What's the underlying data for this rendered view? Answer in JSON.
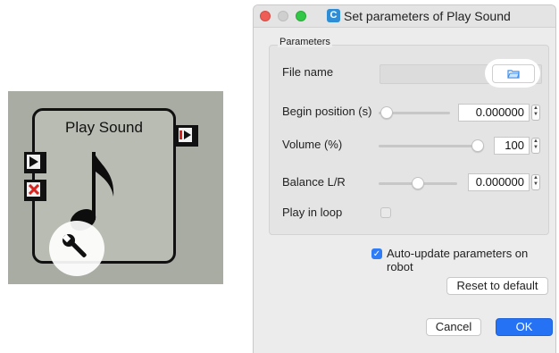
{
  "box": {
    "title": "Play Sound",
    "icons": [
      "start-input-port-icon",
      "stop-input-port-icon",
      "done-output-port-icon",
      "music-note-icon",
      "wrench-icon"
    ]
  },
  "dialog": {
    "app_icon": "C",
    "title": "Set parameters of Play Sound",
    "group_label": "Parameters",
    "file_name": {
      "label": "File name",
      "value": ""
    },
    "begin_position": {
      "label": "Begin position (s)",
      "value": "0.000000",
      "slider_fraction": 0.0
    },
    "volume": {
      "label": "Volume (%)",
      "value": "100",
      "slider_fraction": 1.0
    },
    "balance": {
      "label": "Balance L/R",
      "value": "0.000000",
      "slider_fraction": 0.5
    },
    "play_in_loop": {
      "label": "Play in loop",
      "checked": false
    },
    "auto_update": {
      "label": "Auto-update parameters on robot",
      "checked": true
    },
    "reset_label": "Reset to default",
    "cancel_label": "Cancel",
    "ok_label": "OK",
    "colors": {
      "accent": "#2672f5",
      "close": "#ee5e57",
      "maximize": "#33c748"
    }
  }
}
